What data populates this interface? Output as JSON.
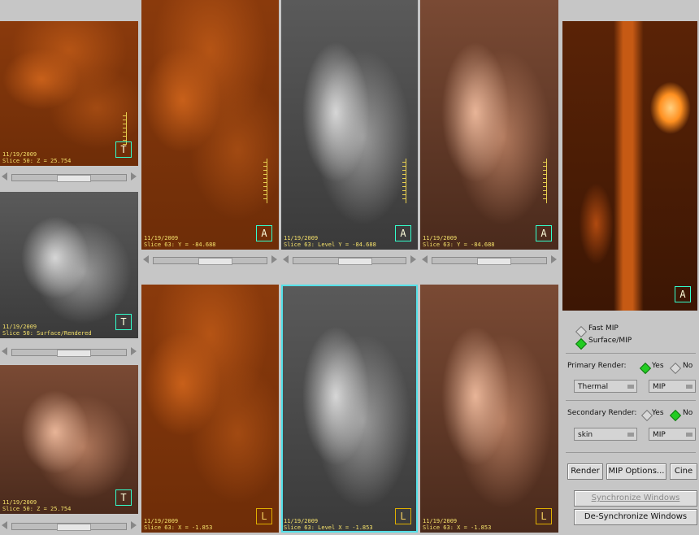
{
  "left_column": {
    "vp1": {
      "date": "11/19/2009",
      "info": "Slice 50: Z = 25.754",
      "orientation": "T"
    },
    "vp2": {
      "date": "11/19/2009",
      "info": "Slice 50: Surface/Rendered",
      "orientation": "T"
    },
    "vp3": {
      "date": "11/19/2009",
      "info": "Slice 50: Z = 25.754",
      "orientation": "T"
    }
  },
  "top_row": {
    "pet": {
      "date": "11/19/2009",
      "info": "Slice 63: Y = -84.688",
      "orientation": "A"
    },
    "ct": {
      "date": "11/19/2009",
      "info": "Slice 63: Level Y = -84.688",
      "orientation": "A"
    },
    "fusion": {
      "date": "11/19/2009",
      "info": "Slice 63: Y = -84.688",
      "orientation": "A"
    }
  },
  "bottom_row": {
    "pet": {
      "date": "11/19/2009",
      "info": "Slice 63: X = -1.853",
      "orientation": "L"
    },
    "ct": {
      "date": "11/19/2009",
      "info": "Slice 63: Level X = -1.853",
      "orientation": "L"
    },
    "fusion": {
      "date": "11/19/2009",
      "info": "Slice 63: X = -1.853",
      "orientation": "L"
    }
  },
  "mip_view": {
    "orientation": "A"
  },
  "slider_values": {
    "s1": "0.0",
    "s2": "0.0",
    "s3": "0.0",
    "s4": "0.0",
    "s5": "0.0",
    "s6": "0.0",
    "s7": "0.0"
  },
  "panel": {
    "mode_options": [
      {
        "label": "Fast MIP",
        "selected": false
      },
      {
        "label": "Surface/MIP",
        "selected": true
      }
    ],
    "primary_render_label": "Primary Render:",
    "primary_yes": "Yes",
    "primary_no": "No",
    "primary_yes_selected": true,
    "primary_colormap": "Thermal",
    "primary_mode": "MIP",
    "secondary_render_label": "Secondary Render:",
    "secondary_yes": "Yes",
    "secondary_no": "No",
    "secondary_no_selected": true,
    "secondary_colormap": "skin",
    "secondary_mode": "MIP",
    "render_button": "Render",
    "mip_options_button": "MIP Options...",
    "cine_button": "Cine",
    "sync_button": "Synchronize Windows",
    "desync_button": "De-Synchronize Windows"
  },
  "colors": {
    "orient_pet": "#33ffcc",
    "orient_lateral": "#e0b000",
    "active_border": "#55e0e8",
    "radio_on": "#22cc22"
  }
}
